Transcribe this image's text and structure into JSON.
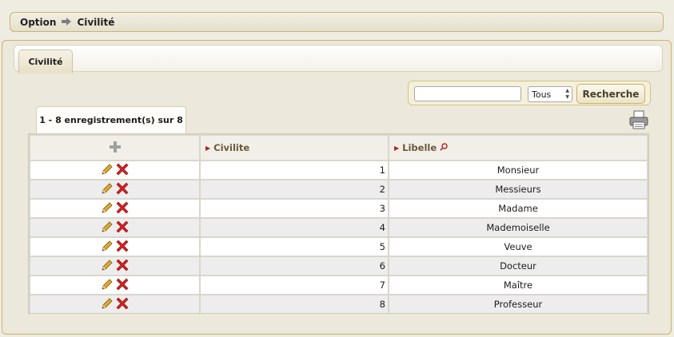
{
  "breadcrumb": {
    "parent": "Option",
    "current": "Civilité"
  },
  "tabs": [
    {
      "label": "Civilité"
    }
  ],
  "search": {
    "value": "",
    "filter_selected": "Tous",
    "button_label": "Recherche"
  },
  "records": {
    "summary": "1 - 8 enregistrement(s) sur 8"
  },
  "table": {
    "columns": [
      {
        "label": "Civilite"
      },
      {
        "label": "Libelle"
      }
    ],
    "rows": [
      {
        "id": "1",
        "libelle": "Monsieur"
      },
      {
        "id": "2",
        "libelle": "Messieurs"
      },
      {
        "id": "3",
        "libelle": "Madame"
      },
      {
        "id": "4",
        "libelle": "Mademoiselle"
      },
      {
        "id": "5",
        "libelle": "Veuve"
      },
      {
        "id": "6",
        "libelle": "Docteur"
      },
      {
        "id": "7",
        "libelle": "Maître"
      },
      {
        "id": "8",
        "libelle": "Professeur"
      }
    ]
  },
  "icons": {
    "add": "plus-icon",
    "edit": "pencil-icon",
    "delete": "delete-x-icon",
    "print": "printer-icon",
    "sort": "sort-triangle-icon",
    "search_col": "magnifier-icon"
  },
  "colors": {
    "frame_border": "#c8b56a",
    "header_text": "#6b5a3a",
    "sort_arrow": "#a52a2a",
    "delete_red": "#d42020"
  }
}
